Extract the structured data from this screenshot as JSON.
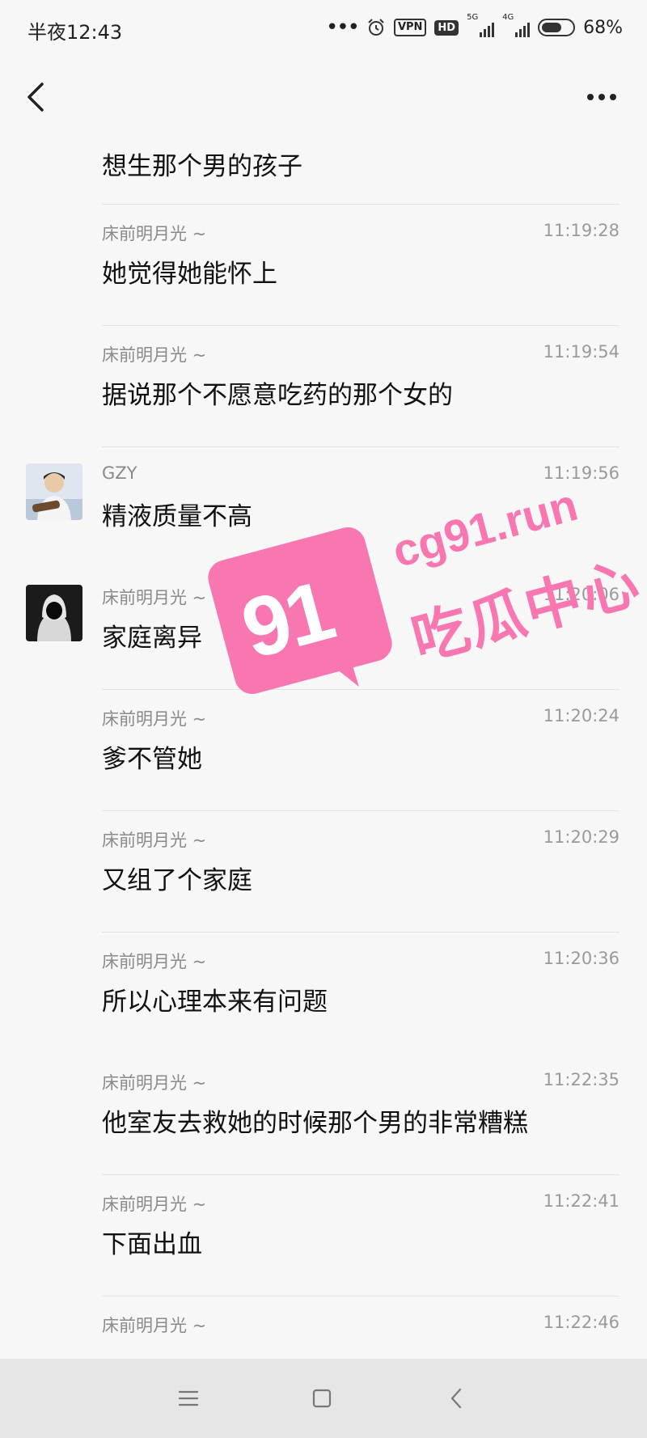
{
  "status_bar": {
    "time": "半夜12:43",
    "vpn": "VPN",
    "hd": "HD",
    "signal_1": "5G",
    "signal_2": "4G",
    "battery": "68%",
    "battery_level": 0.68
  },
  "header": {
    "back_icon": "chevron-left-icon",
    "more_icon": "more-horizontal-icon"
  },
  "messages": [
    {
      "sender": "",
      "time": "",
      "text": "想生那个男的孩子"
    },
    {
      "sender": "床前明月光 ~",
      "time": "11:19:28",
      "text": "她觉得她能怀上"
    },
    {
      "sender": "床前明月光 ~",
      "time": "11:19:54",
      "text": "据说那个不愿意吃药的那个女的"
    },
    {
      "sender": "GZY",
      "time": "11:19:56",
      "text": "精液质量不高"
    },
    {
      "sender": "床前明月光 ~",
      "time": "11:20:06",
      "text": "家庭离异"
    },
    {
      "sender": "床前明月光 ~",
      "time": "11:20:24",
      "text": "爹不管她"
    },
    {
      "sender": "床前明月光 ~",
      "time": "11:20:29",
      "text": "又组了个家庭"
    },
    {
      "sender": "床前明月光 ~",
      "time": "11:20:36",
      "text": "所以心理本来有问题"
    },
    {
      "sender": "床前明月光 ~",
      "time": "11:22:35",
      "text": "他室友去救她的时候那个男的非常糟糕"
    },
    {
      "sender": "床前明月光 ~",
      "time": "11:22:41",
      "text": "下面出血"
    },
    {
      "sender": "床前明月光 ~",
      "time": "11:22:46",
      "text": ""
    }
  ],
  "watermark": {
    "number": "91",
    "url": "cg91.run",
    "name": "吃瓜中心",
    "color": "#f877b0"
  },
  "nav_bar": {
    "menu_icon": "menu-icon",
    "home_icon": "square-home-icon",
    "back_icon": "triangle-back-icon"
  }
}
